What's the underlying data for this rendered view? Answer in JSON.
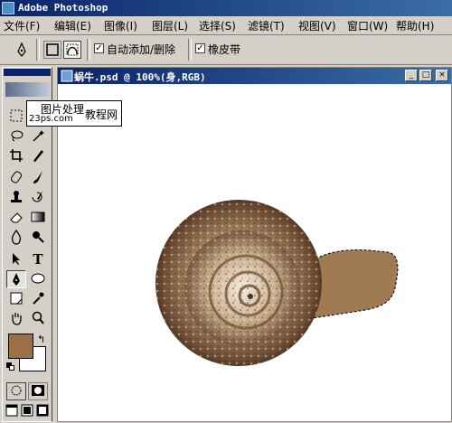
{
  "app": {
    "title": "Adobe Photoshop"
  },
  "menu": [
    "文件(F)",
    "编辑(E)",
    "图像(I)",
    "图层(L)",
    "选择(S)",
    "滤镜(T)",
    "视图(V)",
    "窗口(W)",
    "帮助(H)"
  ],
  "options": {
    "auto_add_delete": "自动添加/删除",
    "rubber_band": "橡皮带"
  },
  "tooltip": {
    "line1": "图片处理",
    "line2": "23ps.com",
    "line3": "教程网"
  },
  "document": {
    "title": "蜗牛.psd @ 100%(身,RGB)"
  },
  "colors": {
    "foreground": "#9c7047",
    "background": "#ffffff",
    "accent": "#0a246a"
  }
}
